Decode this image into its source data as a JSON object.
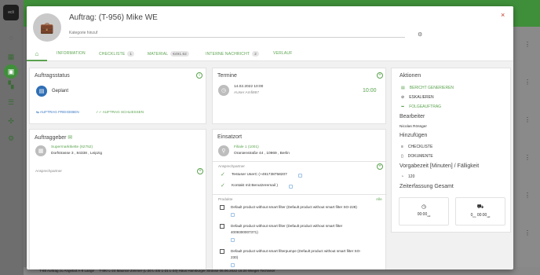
{
  "background": {
    "logo_text": "ecli",
    "bottom_text": "T-88 Auftrag zu Angebot A-9 Lange",
    "bottom_row": "T-8K/ L-24 Maurice Zimmer (L-20 L-24/ L-21 L-24)          Haus Hamburger Strasse          06.06.2022 16:20 Wieger Techniker"
  },
  "modal": {
    "title": "Auftrag: (T-956) Mike WE",
    "category_placeholder": "Kategorie hinzuf",
    "close_label": "×"
  },
  "tabs": [
    {
      "label": "INFORMATION"
    },
    {
      "label": "CHECKLISTE",
      "badge": "1"
    },
    {
      "label": "MATERIAL",
      "badge": "€491.62"
    },
    {
      "label": "INTERNE NACHRICHT",
      "badge": "2"
    },
    {
      "label": "VERLAUF"
    }
  ],
  "auftragsstatus": {
    "title": "Auftragsstatus",
    "status": "Geplant",
    "freigeben": "AUFTRAG FREIGEBEN",
    "schliessen": "AUFTRAG SCHLIESSEN"
  },
  "termine": {
    "title": "Termine",
    "date": "14.02.2022 10:00",
    "user": "AUser Amfi897",
    "time": "10:00"
  },
  "auftraggeber": {
    "title": "Auftraggeber",
    "name": "Supermarktkette (62752)",
    "address": "Dorfstrasse 3 , 84338 , Leipzig",
    "ansprechpartner": "Ansprechpartner"
  },
  "einsatzort": {
    "title": "Einsatzort",
    "name": "Filiale 1 (1001)",
    "address": "Oranienstraße 44 , 10969 , Berlin",
    "ansprechpartner": "Ansprechpartner",
    "contacts": [
      "Testuser UserC (+491738758207",
      "Kontakt mit Benutzeremail )"
    ],
    "produkte_label": "Produkte",
    "alle_label": "Alle",
    "products": [
      [
        "Default product without smart filter (Default product without smart filter SO-228)"
      ],
      [
        "Default product without smart filter (Default product without smart filter",
        "4009300007371)"
      ],
      [
        "Default product without smart filterpumpe (Default product without smart filter SO-",
        "230)"
      ]
    ]
  },
  "aktionen": {
    "title": "Aktionen",
    "items": [
      "BERICHT GENERIEREN",
      "ESKALIEREN",
      "FOLGEAUFTRAG"
    ],
    "bearbeiter_title": "Bearbeiter",
    "bearbeiter": "Nicolas Rössger",
    "hinzufuegen_title": "Hinzufügen",
    "hinzufuegen_items": [
      "CHECKLISTE",
      "DOKUMENTE"
    ],
    "vorgabezeit_title": "Vorgabezeit [Minuten] / Fälligkeit",
    "vorgabezeit": "120",
    "zeiterfassung_title": "Zeiterfassung Gesamt",
    "timer1": "00:00",
    "timer1_unit": "std",
    "timer2_prefix": "0",
    "timer2_prefix_unit": "km",
    "timer2": "00:00",
    "timer2_unit": "std"
  }
}
